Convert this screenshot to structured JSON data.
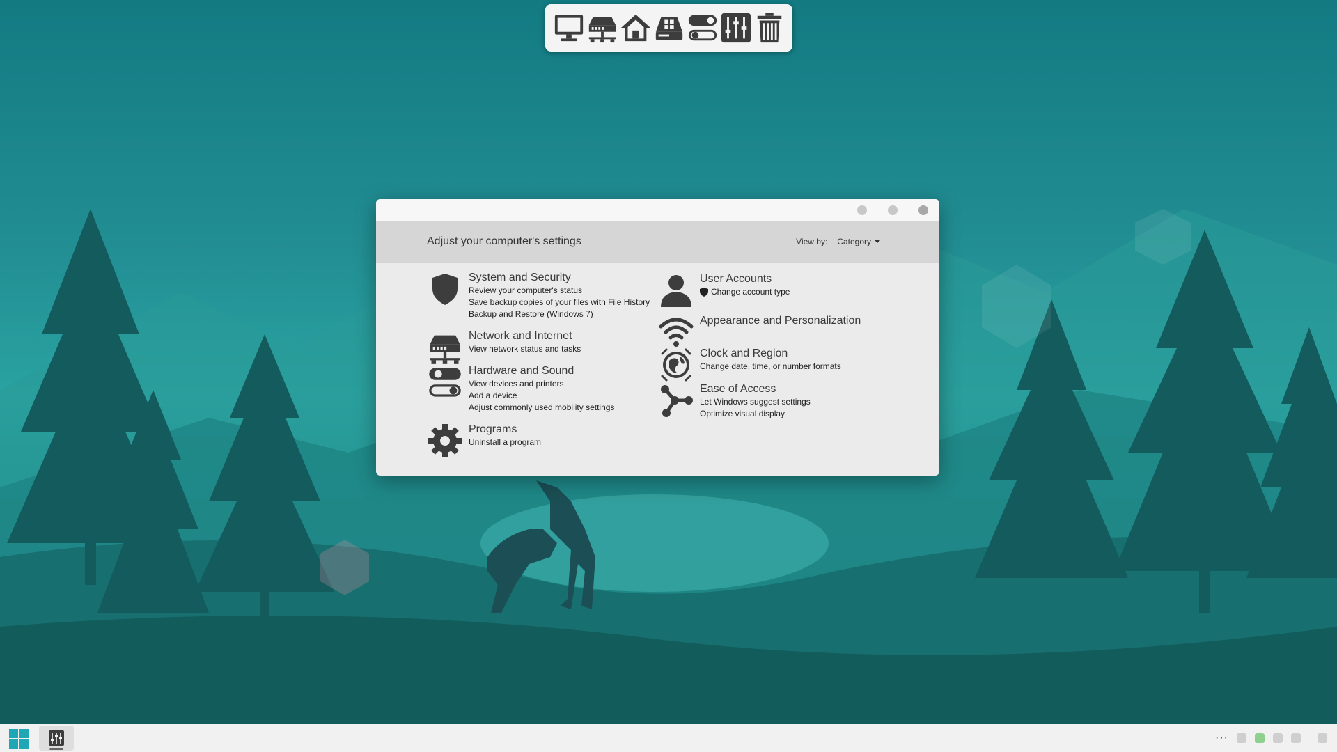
{
  "dock": {
    "items": [
      {
        "name": "computer-icon"
      },
      {
        "name": "network-icon"
      },
      {
        "name": "home-icon"
      },
      {
        "name": "drive-icon"
      },
      {
        "name": "toggles-icon"
      },
      {
        "name": "control-panel-icon"
      },
      {
        "name": "trash-icon"
      }
    ]
  },
  "window": {
    "header_title": "Adjust your computer's settings",
    "view_by_label": "View by:",
    "view_by_value": "Category"
  },
  "categories": {
    "system_security": {
      "title": "System and Security",
      "links": [
        "Review your computer's status",
        "Save backup copies of your files with File History",
        "Backup and Restore (Windows 7)"
      ]
    },
    "network_internet": {
      "title": "Network and Internet",
      "links": [
        "View network status and tasks"
      ]
    },
    "hardware_sound": {
      "title": "Hardware and Sound",
      "links": [
        "View devices and printers",
        "Add a device",
        "Adjust commonly used mobility settings"
      ]
    },
    "programs": {
      "title": "Programs",
      "links": [
        "Uninstall a program"
      ]
    },
    "user_accounts": {
      "title": "User Accounts",
      "links": [
        "Change account type"
      ]
    },
    "appearance": {
      "title": "Appearance and Personalization",
      "links": []
    },
    "clock_region": {
      "title": "Clock and Region",
      "links": [
        "Change date, time, or number formats"
      ]
    },
    "ease_access": {
      "title": "Ease of Access",
      "links": [
        "Let Windows suggest settings",
        "Optimize visual display"
      ]
    }
  },
  "taskbar": {
    "tray_more": "···"
  },
  "colors": {
    "accent": "#1fa7b5",
    "icon": "#3d3d3d"
  }
}
